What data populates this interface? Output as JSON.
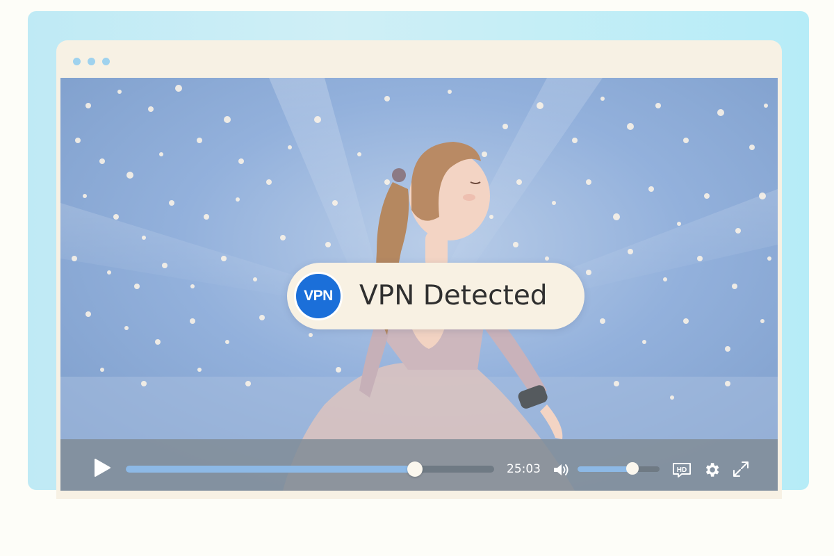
{
  "window": {
    "traffic_lights": [
      "dot",
      "dot",
      "dot"
    ]
  },
  "overlay": {
    "badge_text": "VPN",
    "message": "VPN Detected"
  },
  "player": {
    "current_time": "25:03",
    "progress_fraction": 0.785,
    "volume_fraction": 0.67,
    "icons": [
      "play-icon",
      "volume-icon",
      "hd-icon",
      "gear-icon",
      "fullscreen-icon"
    ]
  },
  "colors": {
    "accent": "#1b6fd9",
    "progress": "#8db9e6",
    "backdrop": "#bfeaf5"
  }
}
